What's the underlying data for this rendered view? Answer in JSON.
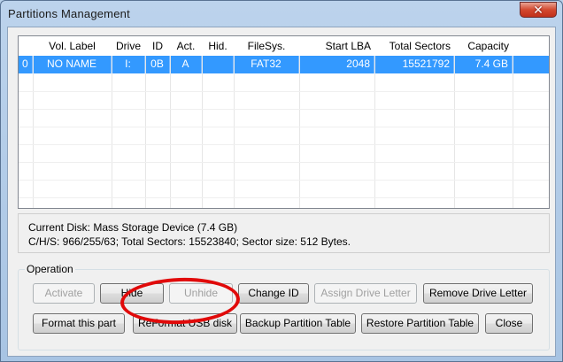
{
  "window": {
    "title": "Partitions Management",
    "close_glyph": "✕"
  },
  "table": {
    "columns": [
      "",
      "Vol. Label",
      "Drive",
      "ID",
      "Act.",
      "Hid.",
      "FileSys.",
      "Start LBA",
      "Total Sectors",
      "Capacity"
    ],
    "rows": [
      [
        "0",
        "NO NAME",
        "I:",
        "0B",
        "A",
        "",
        "FAT32",
        "2048",
        "15521792",
        "7.4 GB"
      ]
    ],
    "selected_row": 0
  },
  "info": {
    "line1": "Current Disk:  Mass Storage Device (7.4 GB)",
    "line2": "C/H/S: 966/255/63; Total Sectors: 15523840; Sector size: 512 Bytes."
  },
  "operation": {
    "label": "Operation",
    "buttons": {
      "activate": "Activate",
      "hide": "Hide",
      "unhide": "Unhide",
      "change_id": "Change ID",
      "assign_drive_letter": "Assign Drive Letter",
      "remove_drive_letter": "Remove Drive Letter",
      "format_part": "Format this part",
      "reformat_usb": "ReFormat USB disk",
      "backup_table": "Backup Partition Table",
      "restore_table": "Restore Partition Table",
      "close": "Close"
    }
  },
  "colors": {
    "selection": "#3399ff",
    "annotation": "#e10a0a",
    "close_button": "#d3492f"
  }
}
